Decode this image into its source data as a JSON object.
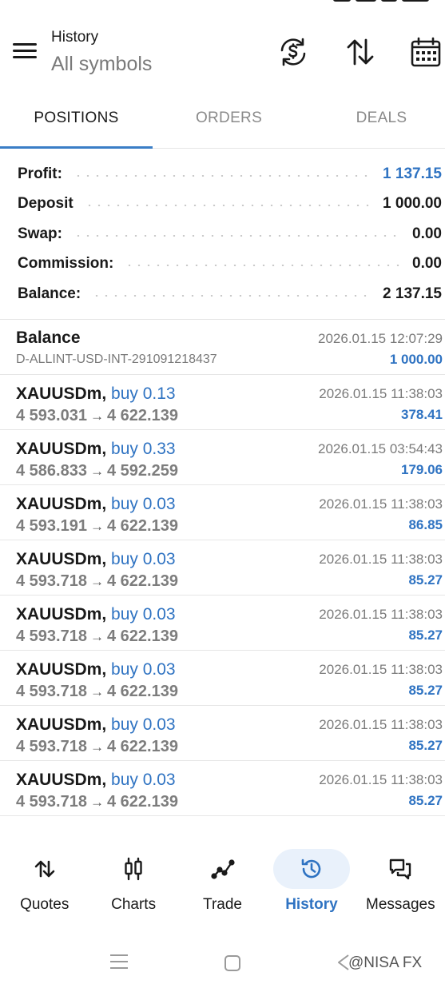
{
  "header": {
    "title": "History",
    "subtitle": "All symbols",
    "icons": [
      "currency-exchange-icon",
      "sort-arrows-icon",
      "calendar-icon"
    ]
  },
  "tabs": [
    {
      "label": "POSITIONS",
      "active": true
    },
    {
      "label": "ORDERS",
      "active": false
    },
    {
      "label": "DEALS",
      "active": false
    }
  ],
  "summary": [
    {
      "label": "Profit:",
      "value": "1 137.15",
      "highlight": true
    },
    {
      "label": "Deposit",
      "value": "1 000.00",
      "highlight": false
    },
    {
      "label": "Swap:",
      "value": "0.00",
      "highlight": false
    },
    {
      "label": "Commission:",
      "value": "0.00",
      "highlight": false
    },
    {
      "label": "Balance:",
      "value": "2 137.15",
      "highlight": false
    }
  ],
  "balance_entry": {
    "title": "Balance",
    "account": "D-ALLINT-USD-INT-291091218437",
    "time": "2026.01.15 12:07:29",
    "amount": "1 000.00"
  },
  "positions": [
    {
      "symbol": "XAUUSDm,",
      "direction": "buy 0.13",
      "open": "4 593.031",
      "close": "4 622.139",
      "time": "2026.01.15 11:38:03",
      "profit": "378.41"
    },
    {
      "symbol": "XAUUSDm,",
      "direction": "buy 0.33",
      "open": "4 586.833",
      "close": "4 592.259",
      "time": "2026.01.15 03:54:43",
      "profit": "179.06"
    },
    {
      "symbol": "XAUUSDm,",
      "direction": "buy 0.03",
      "open": "4 593.191",
      "close": "4 622.139",
      "time": "2026.01.15 11:38:03",
      "profit": "86.85"
    },
    {
      "symbol": "XAUUSDm,",
      "direction": "buy 0.03",
      "open": "4 593.718",
      "close": "4 622.139",
      "time": "2026.01.15 11:38:03",
      "profit": "85.27"
    },
    {
      "symbol": "XAUUSDm,",
      "direction": "buy 0.03",
      "open": "4 593.718",
      "close": "4 622.139",
      "time": "2026.01.15 11:38:03",
      "profit": "85.27"
    },
    {
      "symbol": "XAUUSDm,",
      "direction": "buy 0.03",
      "open": "4 593.718",
      "close": "4 622.139",
      "time": "2026.01.15 11:38:03",
      "profit": "85.27"
    },
    {
      "symbol": "XAUUSDm,",
      "direction": "buy 0.03",
      "open": "4 593.718",
      "close": "4 622.139",
      "time": "2026.01.15 11:38:03",
      "profit": "85.27"
    },
    {
      "symbol": "XAUUSDm,",
      "direction": "buy 0.03",
      "open": "4 593.718",
      "close": "4 622.139",
      "time": "2026.01.15 11:38:03",
      "profit": "85.27"
    }
  ],
  "arrow_glyph": "→",
  "bottom_nav": [
    {
      "label": "Quotes",
      "icon": "quotes-arrows-icon",
      "active": false
    },
    {
      "label": "Charts",
      "icon": "candlestick-icon",
      "active": false
    },
    {
      "label": "Trade",
      "icon": "trade-line-icon",
      "active": false
    },
    {
      "label": "History",
      "icon": "history-clock-icon",
      "active": true
    },
    {
      "label": "Messages",
      "icon": "chat-bubbles-icon",
      "active": false
    }
  ],
  "watermark": "@NISA FX",
  "colors": {
    "accent": "#2f73c2",
    "tab_indicator": "#3a7ec6",
    "muted": "#7a7a7a"
  }
}
